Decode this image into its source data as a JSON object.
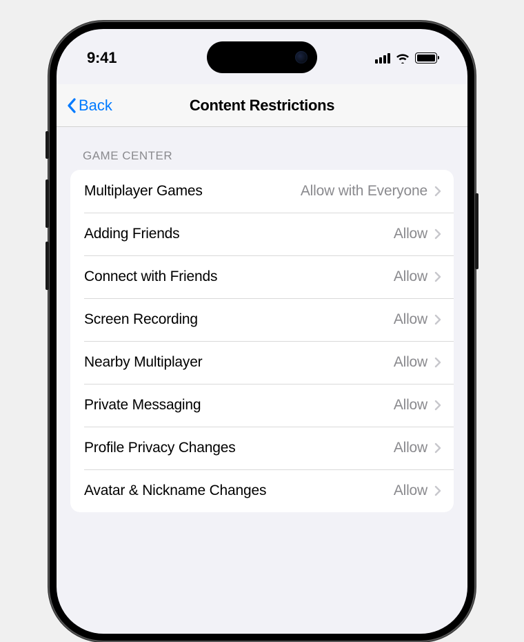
{
  "status_bar": {
    "time": "9:41"
  },
  "nav": {
    "back_label": "Back",
    "title": "Content Restrictions"
  },
  "section": {
    "header": "Game Center",
    "rows": [
      {
        "label": "Multiplayer Games",
        "value": "Allow with Everyone"
      },
      {
        "label": "Adding Friends",
        "value": "Allow"
      },
      {
        "label": "Connect with Friends",
        "value": "Allow"
      },
      {
        "label": "Screen Recording",
        "value": "Allow"
      },
      {
        "label": "Nearby Multiplayer",
        "value": "Allow"
      },
      {
        "label": "Private Messaging",
        "value": "Allow"
      },
      {
        "label": "Profile Privacy Changes",
        "value": "Allow"
      },
      {
        "label": "Avatar & Nickname Changes",
        "value": "Allow"
      }
    ]
  }
}
